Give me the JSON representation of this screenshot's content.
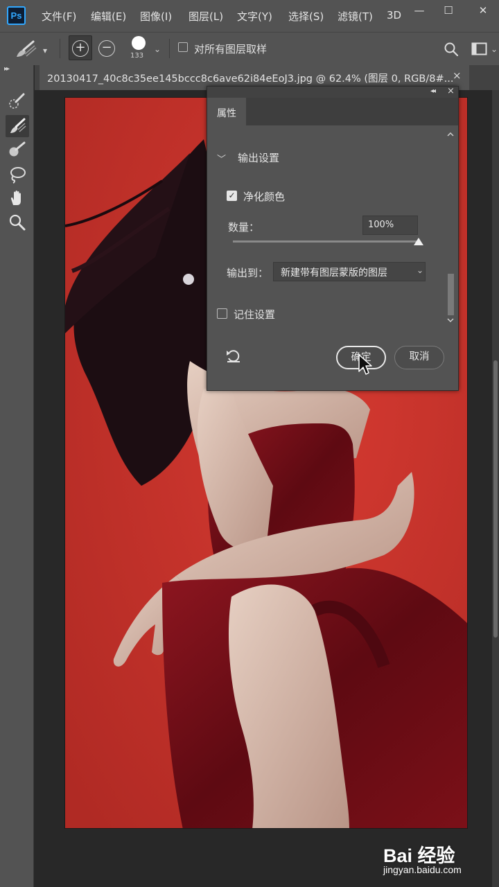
{
  "app": {
    "logo": "Ps"
  },
  "menu": {
    "items": [
      "文件(F)",
      "编辑(E)",
      "图像(I)",
      "图层(L)",
      "文字(Y)",
      "选择(S)",
      "滤镜(T)",
      "3D"
    ]
  },
  "window_controls": {
    "minimize": "—",
    "maximize": "☐",
    "close": "✕"
  },
  "options_bar": {
    "brush_size": "133",
    "sample_all_layers_label": "对所有图层取样",
    "sample_all_layers_checked": false
  },
  "document": {
    "tab_title": "20130417_40c8c35ee145bccc8c6ave62i84eEoJ3.jpg @ 62.4% (图层 0, RGB/8#...",
    "close": "×"
  },
  "properties_panel": {
    "tab_label": "属性",
    "section_title": "输出设置",
    "decontaminate_label": "净化颜色",
    "decontaminate_checked": true,
    "amount_label": "数量：",
    "amount_value": "100%",
    "amount_level": 1.0,
    "output_to_label": "输出到：",
    "output_to_value": "新建带有图层蒙版的图层",
    "remember_label": "记住设置",
    "remember_checked": false,
    "ok_label": "确定",
    "cancel_label": "取消"
  },
  "watermark": {
    "main": "Bai 经验",
    "sub": "jingyan.baidu.com"
  },
  "colors": {
    "ui_dark": "#535353",
    "accent_ps": "#31a8ff",
    "photo_bg": "#c4342c",
    "dress": "#6e0c14"
  }
}
